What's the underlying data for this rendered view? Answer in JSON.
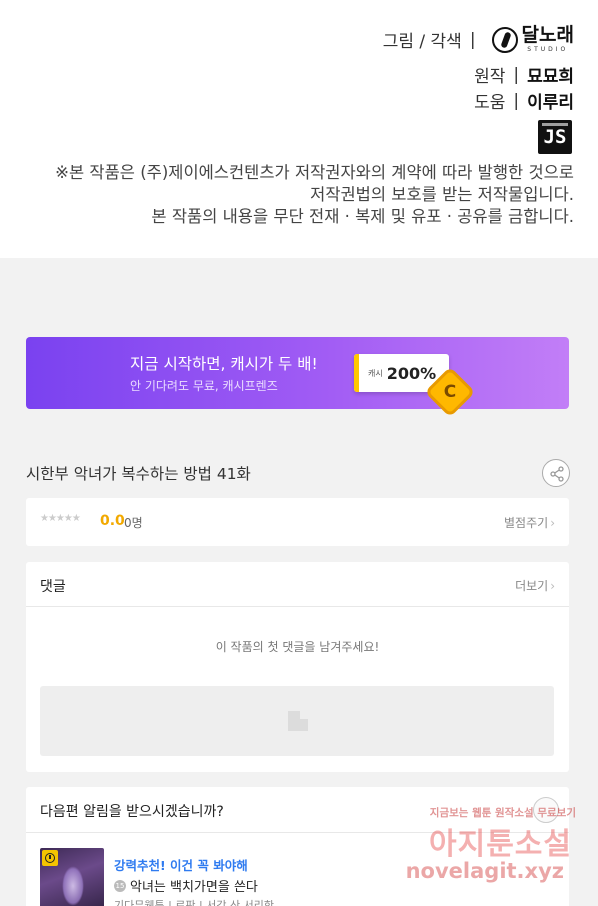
{
  "credits": {
    "art_label": "그림 / 각색",
    "separator": "|",
    "studio_name": "달노래",
    "studio_sub": "STUDIO",
    "original_label": "원작",
    "original_author": "묘묘희",
    "assist_label": "도움",
    "assist_author": "이루리",
    "publisher_badge": "JS",
    "notice_lines": [
      "※본 작품은 (주)제이에스컨텐츠가 저작권자와의 계약에 따라 발행한 것으로",
      "저작권법의 보호를 받는 저작물입니다.",
      "본 작품의 내용을 무단 전재 · 복제 및 유포 · 공유를 금합니다."
    ]
  },
  "banner": {
    "title": "지금 시작하면, 캐시가 두 배!",
    "subtitle": "안 기다려도 무료, 캐시프렌즈",
    "cash_label": "캐시",
    "cash_percent": "200%",
    "coin_letter": "C",
    "colors": {
      "start": "#7a42f0",
      "end": "#c27ef7",
      "accent": "#ffc800"
    }
  },
  "episode": {
    "title": "시한부 악녀가 복수하는 방법 41화",
    "share_icon": "share-icon"
  },
  "rating": {
    "stars": "★★★★★",
    "score": "0.0",
    "count": "0명",
    "rate_label": "별점주기"
  },
  "comments": {
    "title": "댓글",
    "more_label": "더보기",
    "empty_message": "이 작품의 첫 댓글을 남겨주세요!"
  },
  "notify": {
    "question": "다음편 알림을 받으시겠습니까?",
    "recommend": {
      "label": "강력추천! 이건 꼭 봐야해",
      "age_badge": "15",
      "title": "악녀는 백치가면을 쓴다",
      "meta": "기다무웹툰 | 로판 | 서강 산 서리한"
    }
  },
  "watermark": {
    "top": "지금보는 웹툰 원작소설 무료보기",
    "middle": "아지툰소설",
    "bottom": "novelagit.xyz"
  },
  "chevron": "›"
}
